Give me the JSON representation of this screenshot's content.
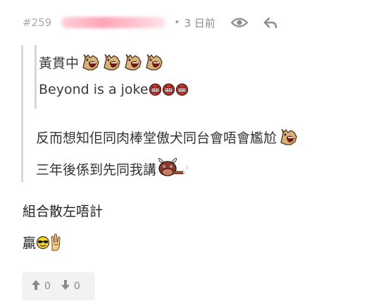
{
  "post": {
    "number": "#259",
    "dot": "•",
    "time": "3 日前"
  },
  "icons": {
    "view": "eye-icon",
    "reply": "reply-icon",
    "upvote": "arrow-up-icon",
    "downvote": "arrow-down-icon",
    "horse": "horse-emoticon",
    "red_face": "red-laughing-face-emoticon",
    "bull": "bull-cigar-emoticon",
    "cool": "sunglasses-face-emoticon",
    "rock_hand": "rock-hand-emoticon"
  },
  "quote_nested": {
    "line1": "黃貫中",
    "line2": "Beyond is a joke"
  },
  "quote": {
    "line1": "反而想知佢同肉棒堂傲犬同台會唔會尷尬",
    "line2": "三年後係到先同我講"
  },
  "reply": {
    "line1": "組合散左唔計",
    "line2": "贏"
  },
  "votes": {
    "up_count": "0",
    "down_count": "0"
  },
  "colors": {
    "quote_border": "#d6d6d6",
    "meta_text": "#9aa0a6",
    "vote_bg": "#f2f2f2",
    "username_blur": "#ff6f8f"
  }
}
